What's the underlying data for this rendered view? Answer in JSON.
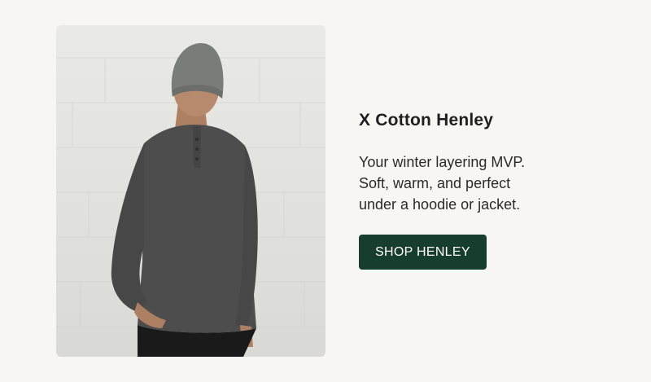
{
  "product": {
    "title": "X Cotton Henley",
    "description_lines": [
      "Your winter layering MVP.",
      "Soft, warm, and perfect",
      "under a hoodie or jacket."
    ],
    "cta_label": "SHOP HENLEY"
  },
  "image": {
    "subject": "man-in-gray-henley-and-beanie",
    "colors": {
      "wall": "#e4e4e1",
      "shirt": "#4d4d4d",
      "beanie": "#7a7c78",
      "skin": "#b88a6d",
      "pants": "#1a1a1a"
    }
  },
  "theme": {
    "background": "#f8f6f3",
    "cta_background": "#173e2c",
    "cta_text": "#ffffff",
    "text": "#1f1f1f"
  }
}
